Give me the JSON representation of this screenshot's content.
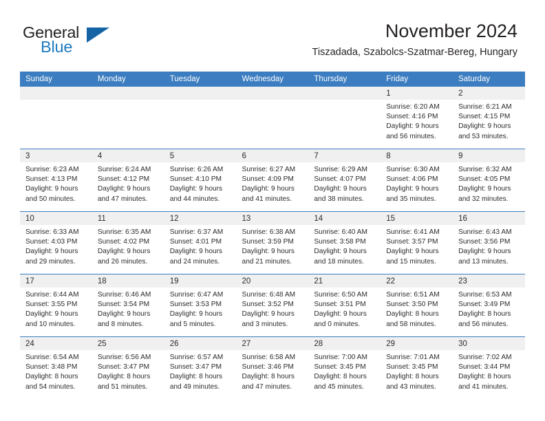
{
  "brand": {
    "name_part1": "General",
    "name_part2": "Blue",
    "mark": "triangle-logo-mark"
  },
  "header": {
    "title": "November 2024",
    "subtitle": "Tiszadada, Szabolcs-Szatmar-Bereg, Hungary"
  },
  "colors": {
    "header_blue": "#3b7dc0",
    "logo_blue": "#1e7bc0",
    "date_strip": "#f0f0f0",
    "text": "#2b2b2b"
  },
  "weekdays": [
    "Sunday",
    "Monday",
    "Tuesday",
    "Wednesday",
    "Thursday",
    "Friday",
    "Saturday"
  ],
  "weeks": [
    [
      {
        "day": "",
        "sunrise": "",
        "sunset": "",
        "daylight1": "",
        "daylight2": "",
        "empty": true
      },
      {
        "day": "",
        "sunrise": "",
        "sunset": "",
        "daylight1": "",
        "daylight2": "",
        "empty": true
      },
      {
        "day": "",
        "sunrise": "",
        "sunset": "",
        "daylight1": "",
        "daylight2": "",
        "empty": true
      },
      {
        "day": "",
        "sunrise": "",
        "sunset": "",
        "daylight1": "",
        "daylight2": "",
        "empty": true
      },
      {
        "day": "",
        "sunrise": "",
        "sunset": "",
        "daylight1": "",
        "daylight2": "",
        "empty": true
      },
      {
        "day": "1",
        "sunrise": "Sunrise: 6:20 AM",
        "sunset": "Sunset: 4:16 PM",
        "daylight1": "Daylight: 9 hours",
        "daylight2": "and 56 minutes.",
        "empty": false
      },
      {
        "day": "2",
        "sunrise": "Sunrise: 6:21 AM",
        "sunset": "Sunset: 4:15 PM",
        "daylight1": "Daylight: 9 hours",
        "daylight2": "and 53 minutes.",
        "empty": false
      }
    ],
    [
      {
        "day": "3",
        "sunrise": "Sunrise: 6:23 AM",
        "sunset": "Sunset: 4:13 PM",
        "daylight1": "Daylight: 9 hours",
        "daylight2": "and 50 minutes.",
        "empty": false
      },
      {
        "day": "4",
        "sunrise": "Sunrise: 6:24 AM",
        "sunset": "Sunset: 4:12 PM",
        "daylight1": "Daylight: 9 hours",
        "daylight2": "and 47 minutes.",
        "empty": false
      },
      {
        "day": "5",
        "sunrise": "Sunrise: 6:26 AM",
        "sunset": "Sunset: 4:10 PM",
        "daylight1": "Daylight: 9 hours",
        "daylight2": "and 44 minutes.",
        "empty": false
      },
      {
        "day": "6",
        "sunrise": "Sunrise: 6:27 AM",
        "sunset": "Sunset: 4:09 PM",
        "daylight1": "Daylight: 9 hours",
        "daylight2": "and 41 minutes.",
        "empty": false
      },
      {
        "day": "7",
        "sunrise": "Sunrise: 6:29 AM",
        "sunset": "Sunset: 4:07 PM",
        "daylight1": "Daylight: 9 hours",
        "daylight2": "and 38 minutes.",
        "empty": false
      },
      {
        "day": "8",
        "sunrise": "Sunrise: 6:30 AM",
        "sunset": "Sunset: 4:06 PM",
        "daylight1": "Daylight: 9 hours",
        "daylight2": "and 35 minutes.",
        "empty": false
      },
      {
        "day": "9",
        "sunrise": "Sunrise: 6:32 AM",
        "sunset": "Sunset: 4:05 PM",
        "daylight1": "Daylight: 9 hours",
        "daylight2": "and 32 minutes.",
        "empty": false
      }
    ],
    [
      {
        "day": "10",
        "sunrise": "Sunrise: 6:33 AM",
        "sunset": "Sunset: 4:03 PM",
        "daylight1": "Daylight: 9 hours",
        "daylight2": "and 29 minutes.",
        "empty": false
      },
      {
        "day": "11",
        "sunrise": "Sunrise: 6:35 AM",
        "sunset": "Sunset: 4:02 PM",
        "daylight1": "Daylight: 9 hours",
        "daylight2": "and 26 minutes.",
        "empty": false
      },
      {
        "day": "12",
        "sunrise": "Sunrise: 6:37 AM",
        "sunset": "Sunset: 4:01 PM",
        "daylight1": "Daylight: 9 hours",
        "daylight2": "and 24 minutes.",
        "empty": false
      },
      {
        "day": "13",
        "sunrise": "Sunrise: 6:38 AM",
        "sunset": "Sunset: 3:59 PM",
        "daylight1": "Daylight: 9 hours",
        "daylight2": "and 21 minutes.",
        "empty": false
      },
      {
        "day": "14",
        "sunrise": "Sunrise: 6:40 AM",
        "sunset": "Sunset: 3:58 PM",
        "daylight1": "Daylight: 9 hours",
        "daylight2": "and 18 minutes.",
        "empty": false
      },
      {
        "day": "15",
        "sunrise": "Sunrise: 6:41 AM",
        "sunset": "Sunset: 3:57 PM",
        "daylight1": "Daylight: 9 hours",
        "daylight2": "and 15 minutes.",
        "empty": false
      },
      {
        "day": "16",
        "sunrise": "Sunrise: 6:43 AM",
        "sunset": "Sunset: 3:56 PM",
        "daylight1": "Daylight: 9 hours",
        "daylight2": "and 13 minutes.",
        "empty": false
      }
    ],
    [
      {
        "day": "17",
        "sunrise": "Sunrise: 6:44 AM",
        "sunset": "Sunset: 3:55 PM",
        "daylight1": "Daylight: 9 hours",
        "daylight2": "and 10 minutes.",
        "empty": false
      },
      {
        "day": "18",
        "sunrise": "Sunrise: 6:46 AM",
        "sunset": "Sunset: 3:54 PM",
        "daylight1": "Daylight: 9 hours",
        "daylight2": "and 8 minutes.",
        "empty": false
      },
      {
        "day": "19",
        "sunrise": "Sunrise: 6:47 AM",
        "sunset": "Sunset: 3:53 PM",
        "daylight1": "Daylight: 9 hours",
        "daylight2": "and 5 minutes.",
        "empty": false
      },
      {
        "day": "20",
        "sunrise": "Sunrise: 6:48 AM",
        "sunset": "Sunset: 3:52 PM",
        "daylight1": "Daylight: 9 hours",
        "daylight2": "and 3 minutes.",
        "empty": false
      },
      {
        "day": "21",
        "sunrise": "Sunrise: 6:50 AM",
        "sunset": "Sunset: 3:51 PM",
        "daylight1": "Daylight: 9 hours",
        "daylight2": "and 0 minutes.",
        "empty": false
      },
      {
        "day": "22",
        "sunrise": "Sunrise: 6:51 AM",
        "sunset": "Sunset: 3:50 PM",
        "daylight1": "Daylight: 8 hours",
        "daylight2": "and 58 minutes.",
        "empty": false
      },
      {
        "day": "23",
        "sunrise": "Sunrise: 6:53 AM",
        "sunset": "Sunset: 3:49 PM",
        "daylight1": "Daylight: 8 hours",
        "daylight2": "and 56 minutes.",
        "empty": false
      }
    ],
    [
      {
        "day": "24",
        "sunrise": "Sunrise: 6:54 AM",
        "sunset": "Sunset: 3:48 PM",
        "daylight1": "Daylight: 8 hours",
        "daylight2": "and 54 minutes.",
        "empty": false
      },
      {
        "day": "25",
        "sunrise": "Sunrise: 6:56 AM",
        "sunset": "Sunset: 3:47 PM",
        "daylight1": "Daylight: 8 hours",
        "daylight2": "and 51 minutes.",
        "empty": false
      },
      {
        "day": "26",
        "sunrise": "Sunrise: 6:57 AM",
        "sunset": "Sunset: 3:47 PM",
        "daylight1": "Daylight: 8 hours",
        "daylight2": "and 49 minutes.",
        "empty": false
      },
      {
        "day": "27",
        "sunrise": "Sunrise: 6:58 AM",
        "sunset": "Sunset: 3:46 PM",
        "daylight1": "Daylight: 8 hours",
        "daylight2": "and 47 minutes.",
        "empty": false
      },
      {
        "day": "28",
        "sunrise": "Sunrise: 7:00 AM",
        "sunset": "Sunset: 3:45 PM",
        "daylight1": "Daylight: 8 hours",
        "daylight2": "and 45 minutes.",
        "empty": false
      },
      {
        "day": "29",
        "sunrise": "Sunrise: 7:01 AM",
        "sunset": "Sunset: 3:45 PM",
        "daylight1": "Daylight: 8 hours",
        "daylight2": "and 43 minutes.",
        "empty": false
      },
      {
        "day": "30",
        "sunrise": "Sunrise: 7:02 AM",
        "sunset": "Sunset: 3:44 PM",
        "daylight1": "Daylight: 8 hours",
        "daylight2": "and 41 minutes.",
        "empty": false
      }
    ]
  ]
}
